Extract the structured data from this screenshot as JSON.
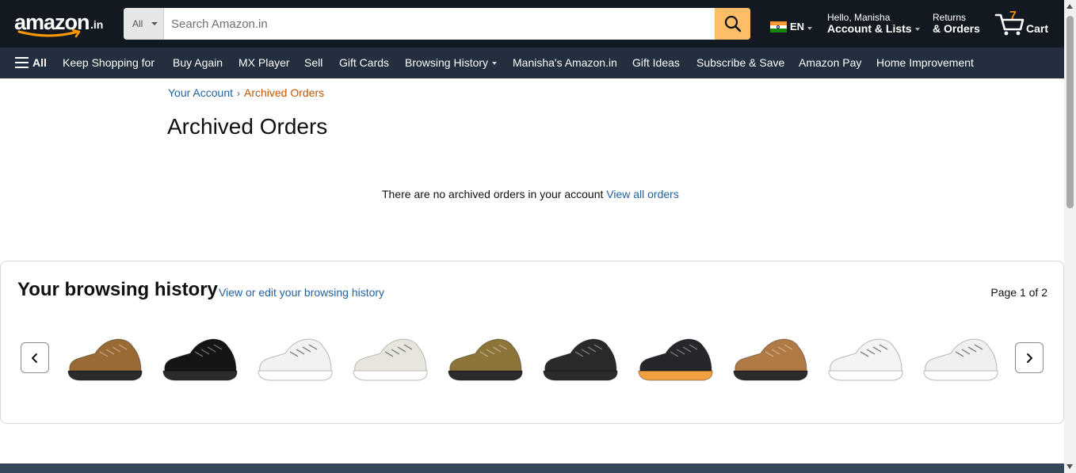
{
  "header": {
    "logo_text": "amazon",
    "logo_tld": ".in",
    "search_category": "All",
    "search_placeholder": "Search Amazon.in",
    "language": "EN",
    "greeting": "Hello, Manisha",
    "account_label": "Account & Lists",
    "returns_label": "Returns",
    "orders_label": "& Orders",
    "cart_count": "7",
    "cart_label": "Cart"
  },
  "subnav": {
    "all_label": "All",
    "items": [
      "Keep Shopping for",
      "Buy Again",
      "MX Player",
      "Sell",
      "Gift Cards",
      "Browsing History",
      "Manisha's Amazon.in",
      "Gift Ideas",
      "Subscribe & Save",
      "Amazon Pay",
      "Home Improvement"
    ]
  },
  "breadcrumb": {
    "parent": "Your Account",
    "separator": "›",
    "current": "Archived Orders"
  },
  "page_title": "Archived Orders",
  "empty_state": {
    "message": "There are no archived orders in your account",
    "link": "View all orders"
  },
  "browsing_history": {
    "title": "Your browsing history",
    "edit_link": "View or edit your browsing history",
    "page_indicator": "Page 1 of 2",
    "products": [
      {
        "name": "brown-leather-sneaker",
        "color": "#9a6a35"
      },
      {
        "name": "black-formal-shoe",
        "color": "#151515"
      },
      {
        "name": "white-sneaker",
        "color": "#f2f2f2"
      },
      {
        "name": "white-running-shoe",
        "color": "#e8e6dc"
      },
      {
        "name": "olive-suede-shoe",
        "color": "#8d7438"
      },
      {
        "name": "black-camo-trail-shoe",
        "color": "#2a2a2a"
      },
      {
        "name": "black-orange-running-shoe",
        "color": "#26272b"
      },
      {
        "name": "tan-loafer",
        "color": "#b07a44"
      },
      {
        "name": "white-chunky-sneaker",
        "color": "#f4f4f4"
      },
      {
        "name": "white-sports-shoe",
        "color": "#f0f0f2"
      }
    ]
  },
  "colors": {
    "nav_bg": "#131921",
    "subnav_bg": "#232f3e",
    "search_button": "#febd69",
    "link": "#2162a1",
    "current_crumb": "#c45500",
    "cart_count": "#f08804"
  }
}
